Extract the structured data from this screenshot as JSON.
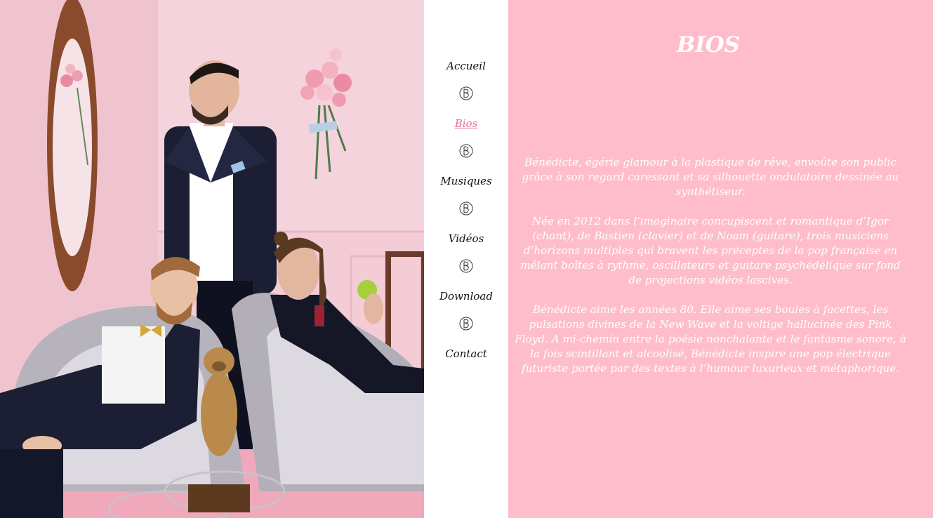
{
  "nav": {
    "items": [
      {
        "label": "Accueil",
        "active": false
      },
      {
        "label": "Bios",
        "active": true
      },
      {
        "label": "Musiques",
        "active": false
      },
      {
        "label": "Vidéos",
        "active": false
      },
      {
        "label": "Download",
        "active": false
      },
      {
        "label": "Contact",
        "active": false
      }
    ],
    "separator_icon": "b-monogram-icon"
  },
  "main": {
    "title": "BIOS",
    "paragraphs": [
      "Bénédicte, égérie glamour à la plastique de rêve, envoûte son public grâce à son regard caressant et sa silhouette ondulatoire dessinée au synthétiseur.",
      "Née en 2012 dans l’imaginaire concupiscent et romantique d’Igor (chant), de Bastien (clavier) et de Noam (guitare), trois musiciens d’horizons multiples qui bravent les préceptes de la pop française en mêlant boîtes à rythme, oscillateurs et guitare psychédélique sur fond de projections vidéos lascives.",
      "Bénédicte aime les années 80. Elle aime ses boules à facettes, les pulsations divines de la New Wave et la voltige hallucinée des Pink Floyd. A mi-chemin entre la poésie nonchalante et le fantasme sonore, à la fois scintillant et alcoolisé, Bénédicte inspire une pop électrique futuriste portée par des textes à l’humour luxurieux et métaphorique."
    ]
  },
  "colors": {
    "content_bg": "#ffbdcb",
    "active_link": "#e2728f",
    "nav_bg": "#ffffff",
    "photo_wall": "#f1c9d3"
  }
}
